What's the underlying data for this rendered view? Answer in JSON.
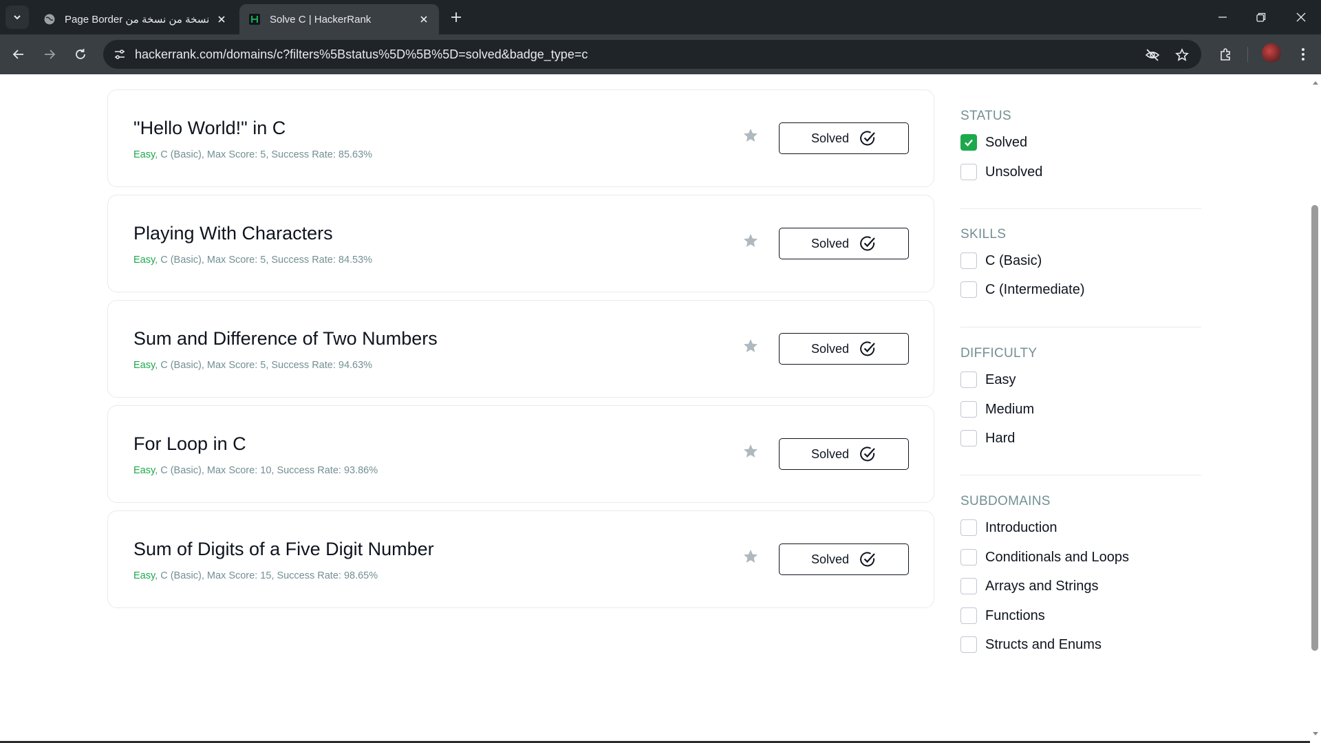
{
  "browser": {
    "tabs": [
      {
        "title": "Page Border نسخة من نسخة من",
        "active": false
      },
      {
        "title": "Solve C | HackerRank",
        "active": true
      }
    ],
    "url": "hackerrank.com/domains/c?filters%5Bstatus%5D%5B%5D=solved&badge_type=c"
  },
  "challenges": [
    {
      "title": "\"Hello World!\" in C",
      "difficulty": "Easy",
      "meta": ", C (Basic), Max Score: 5, Success Rate: 85.63%",
      "button": "Solved"
    },
    {
      "title": "Playing With Characters",
      "difficulty": "Easy",
      "meta": ", C (Basic), Max Score: 5, Success Rate: 84.53%",
      "button": "Solved"
    },
    {
      "title": "Sum and Difference of Two Numbers",
      "difficulty": "Easy",
      "meta": ", C (Basic), Max Score: 5, Success Rate: 94.63%",
      "button": "Solved"
    },
    {
      "title": "For Loop in C",
      "difficulty": "Easy",
      "meta": ", C (Basic), Max Score: 10, Success Rate: 93.86%",
      "button": "Solved"
    },
    {
      "title": "Sum of Digits of a Five Digit Number",
      "difficulty": "Easy",
      "meta": ", C (Basic), Max Score: 15, Success Rate: 98.65%",
      "button": "Solved"
    }
  ],
  "filters": {
    "status": {
      "heading": "STATUS",
      "options": [
        {
          "label": "Solved",
          "checked": true
        },
        {
          "label": "Unsolved",
          "checked": false
        }
      ]
    },
    "skills": {
      "heading": "SKILLS",
      "options": [
        {
          "label": "C (Basic)",
          "checked": false
        },
        {
          "label": "C (Intermediate)",
          "checked": false
        }
      ]
    },
    "difficulty": {
      "heading": "DIFFICULTY",
      "options": [
        {
          "label": "Easy",
          "checked": false
        },
        {
          "label": "Medium",
          "checked": false
        },
        {
          "label": "Hard",
          "checked": false
        }
      ]
    },
    "subdomains": {
      "heading": "SUBDOMAINS",
      "options": [
        {
          "label": "Introduction",
          "checked": false
        },
        {
          "label": "Conditionals and Loops",
          "checked": false
        },
        {
          "label": "Arrays and Strings",
          "checked": false
        },
        {
          "label": "Functions",
          "checked": false
        },
        {
          "label": "Structs and Enums",
          "checked": false
        }
      ]
    }
  },
  "colors": {
    "easy": "#1ba94c",
    "checkbox_checked": "#1ba94c",
    "heading": "#738f93"
  }
}
